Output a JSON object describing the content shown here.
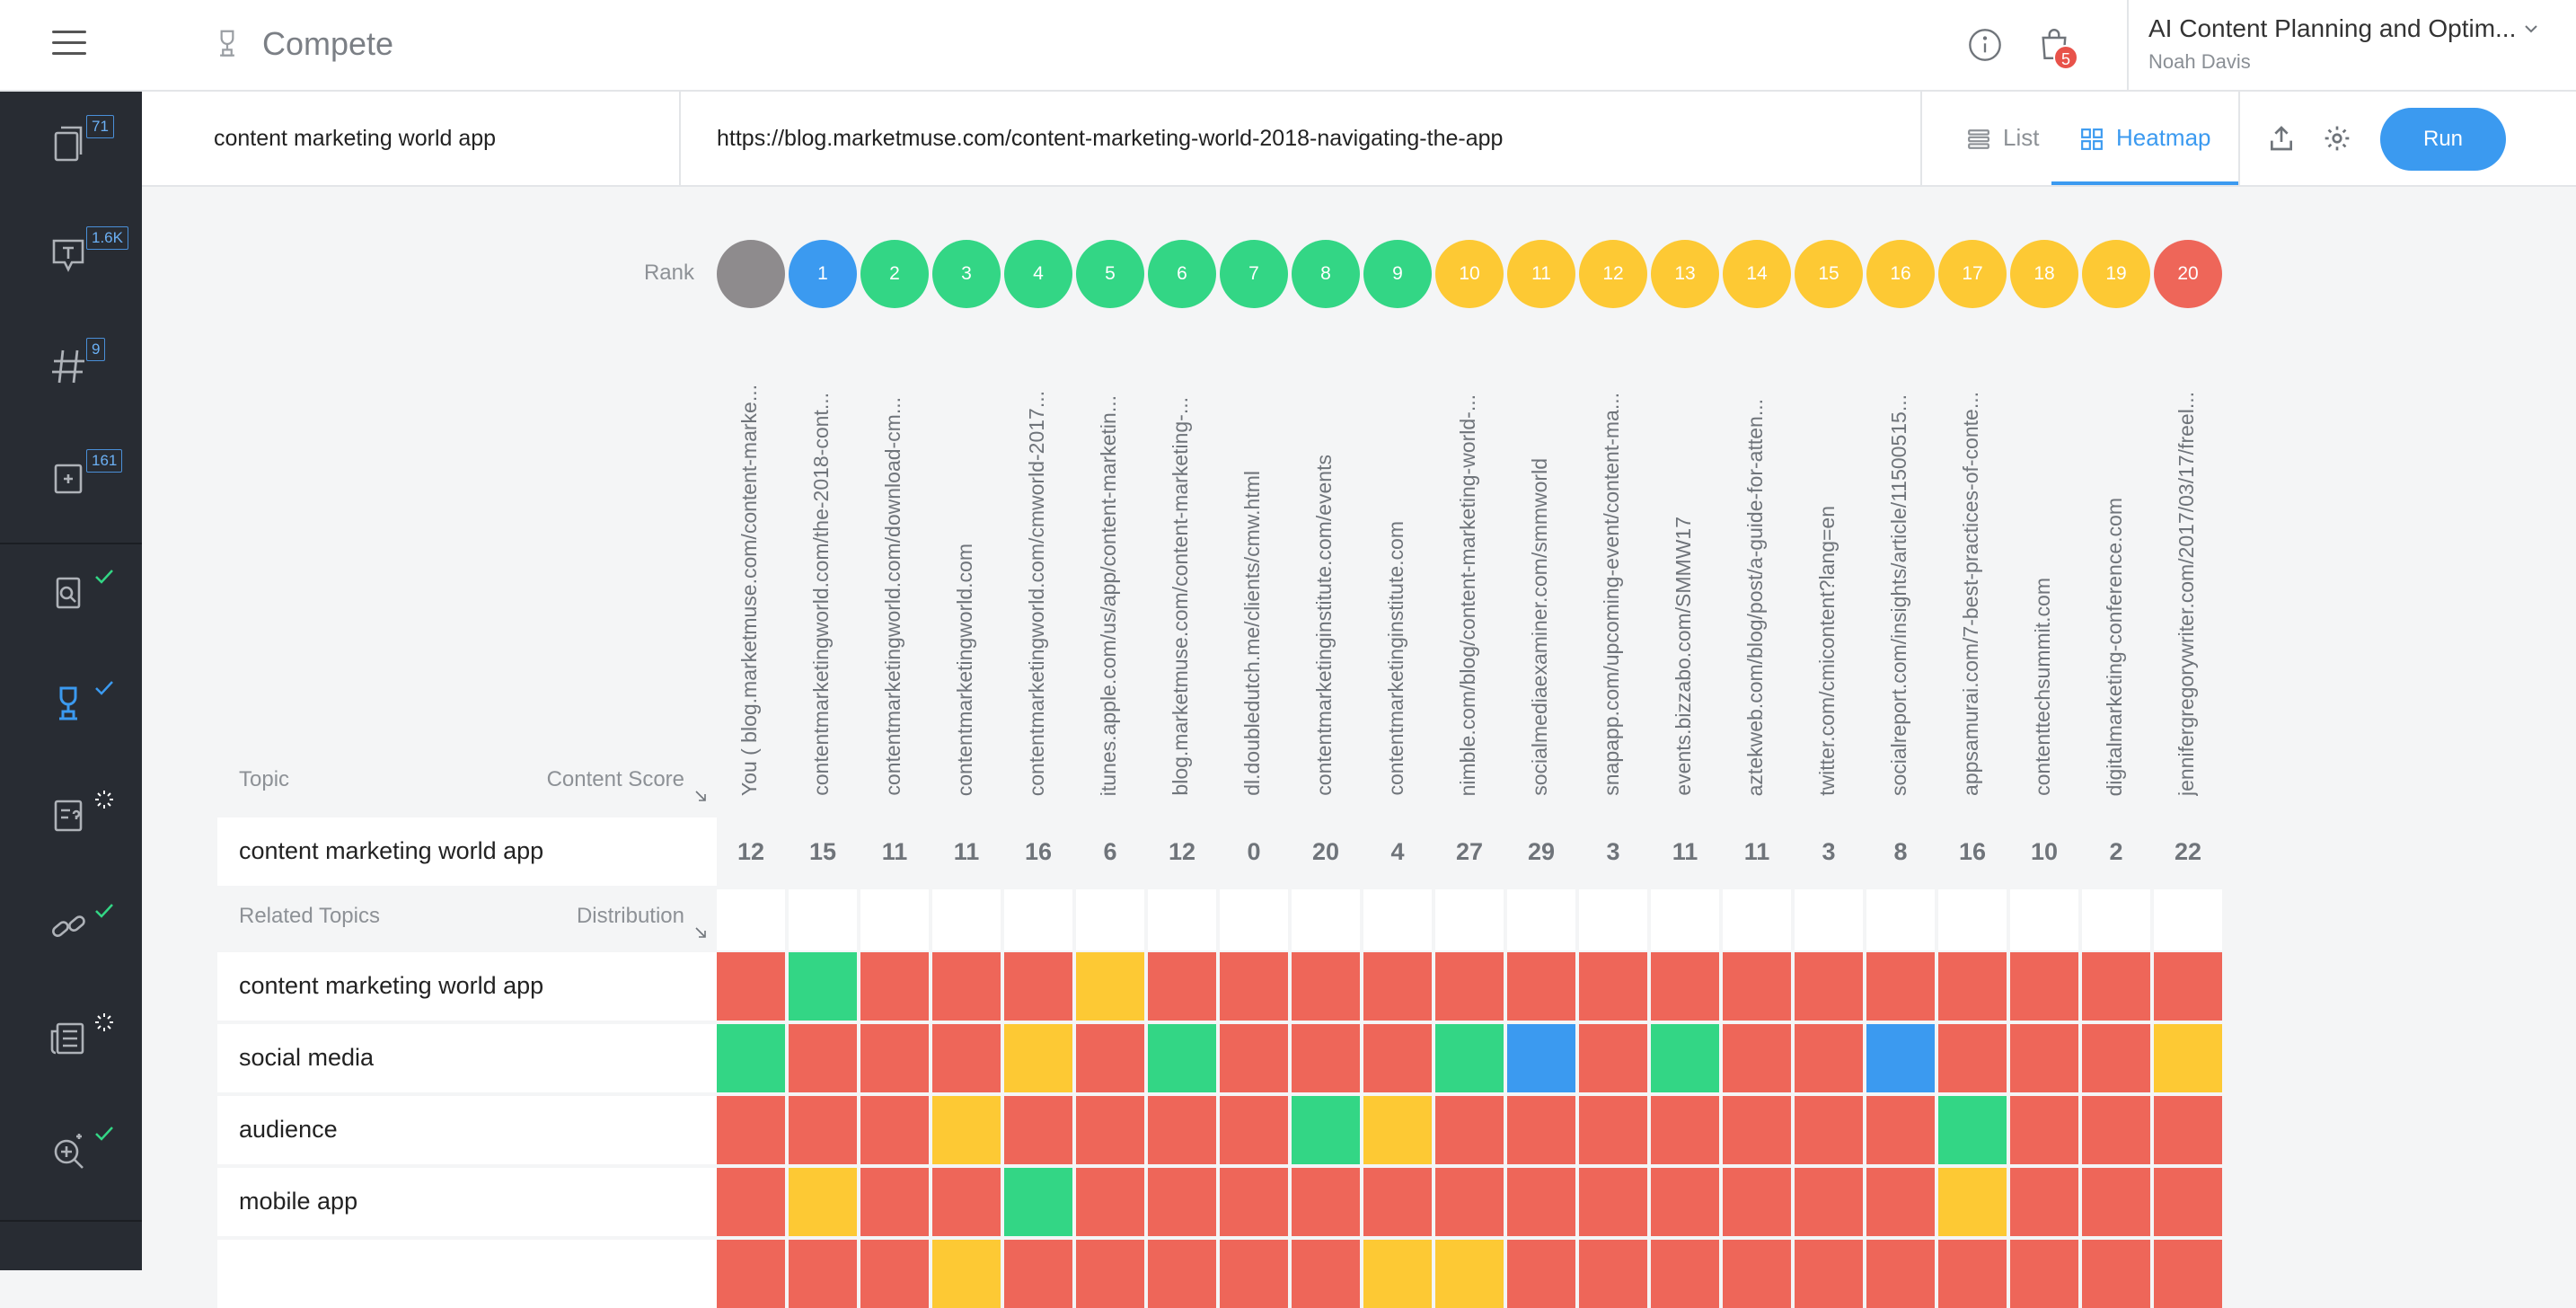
{
  "header": {
    "app_title": "Compete",
    "project_name": "AI Content Planning and Optim...",
    "user_name": "Noah Davis",
    "cart_count": "5"
  },
  "sidebar": {
    "badges": [
      "71",
      "1.6K",
      "9",
      "161"
    ]
  },
  "search": {
    "topic_value": "content marketing world app",
    "url_value": "https://blog.marketmuse.com/content-marketing-world-2018-navigating-the-app"
  },
  "view_tabs": {
    "list_label": "List",
    "heatmap_label": "Heatmap"
  },
  "run_label": "Run",
  "heatmap": {
    "rank_label": "Rank",
    "topic_header": "Topic",
    "score_header": "Content Score",
    "related_header": "Related Topics",
    "distribution_header": "Distribution",
    "focus_topic": "content marketing world app",
    "colors": {
      "gray": "#8e8b8d",
      "blue": "#3b9af0",
      "green": "#33d685",
      "yellow": "#fdc934",
      "red": "#ee6659"
    },
    "columns": [
      {
        "rank": "",
        "color": "gray",
        "url": "You ( blog.marketmuse.com/content-marke...",
        "score": "12"
      },
      {
        "rank": "1",
        "color": "blue",
        "url": "contentmarketingworld.com/the-2018-cont...",
        "score": "15"
      },
      {
        "rank": "2",
        "color": "green",
        "url": "contentmarketingworld.com/download-cm...",
        "score": "11"
      },
      {
        "rank": "3",
        "color": "green",
        "url": "contentmarketingworld.com",
        "score": "11"
      },
      {
        "rank": "4",
        "color": "green",
        "url": "contentmarketingworld.com/cmworld-2017...",
        "score": "16"
      },
      {
        "rank": "5",
        "color": "green",
        "url": "itunes.apple.com/us/app/content-marketin...",
        "score": "6"
      },
      {
        "rank": "6",
        "color": "green",
        "url": "blog.marketmuse.com/content-marketing-...",
        "score": "12"
      },
      {
        "rank": "7",
        "color": "green",
        "url": "dl.doubledutch.me/clients/cmw.html",
        "score": "0"
      },
      {
        "rank": "8",
        "color": "green",
        "url": "contentmarketinginstitute.com/events",
        "score": "20"
      },
      {
        "rank": "9",
        "color": "green",
        "url": "contentmarketinginstitute.com",
        "score": "4"
      },
      {
        "rank": "10",
        "color": "yellow",
        "url": "nimble.com/blog/content-marketing-world-...",
        "score": "27"
      },
      {
        "rank": "11",
        "color": "yellow",
        "url": "socialmediaexaminer.com/smmworld",
        "score": "29"
      },
      {
        "rank": "12",
        "color": "yellow",
        "url": "snapapp.com/upcoming-event/content-ma...",
        "score": "3"
      },
      {
        "rank": "13",
        "color": "yellow",
        "url": "events.bizzabo.com/SMMW17",
        "score": "11"
      },
      {
        "rank": "14",
        "color": "yellow",
        "url": "aztekweb.com/blog/post/a-guide-for-atten...",
        "score": "11"
      },
      {
        "rank": "15",
        "color": "yellow",
        "url": "twitter.com/cmicontent?lang=en",
        "score": "3"
      },
      {
        "rank": "16",
        "color": "yellow",
        "url": "socialreport.com/insights/article/11500515...",
        "score": "8"
      },
      {
        "rank": "17",
        "color": "yellow",
        "url": "appsamurai.com/7-best-practices-of-conte...",
        "score": "16"
      },
      {
        "rank": "18",
        "color": "yellow",
        "url": "contenttechsummit.com",
        "score": "10"
      },
      {
        "rank": "19",
        "color": "yellow",
        "url": "digitalmarketing-conference.com",
        "score": "2"
      },
      {
        "rank": "20",
        "color": "red",
        "url": "jennifergregorywriter.com/2017/03/17/freel...",
        "score": "22"
      }
    ],
    "rows": [
      {
        "topic": "content marketing world app",
        "cells": [
          "red",
          "green",
          "red",
          "red",
          "red",
          "yellow",
          "red",
          "red",
          "red",
          "red",
          "red",
          "red",
          "red",
          "red",
          "red",
          "red",
          "red",
          "red",
          "red",
          "red",
          "red"
        ]
      },
      {
        "topic": "social media",
        "cells": [
          "green",
          "red",
          "red",
          "red",
          "yellow",
          "red",
          "green",
          "red",
          "red",
          "red",
          "green",
          "blue",
          "red",
          "green",
          "red",
          "red",
          "blue",
          "red",
          "red",
          "red",
          "yellow"
        ]
      },
      {
        "topic": "audience",
        "cells": [
          "red",
          "red",
          "red",
          "yellow",
          "red",
          "red",
          "red",
          "red",
          "green",
          "yellow",
          "red",
          "red",
          "red",
          "red",
          "red",
          "red",
          "red",
          "green",
          "red",
          "red",
          "red"
        ]
      },
      {
        "topic": "mobile app",
        "cells": [
          "red",
          "yellow",
          "red",
          "red",
          "green",
          "red",
          "red",
          "red",
          "red",
          "red",
          "red",
          "red",
          "red",
          "red",
          "red",
          "red",
          "red",
          "yellow",
          "red",
          "red",
          "red"
        ]
      },
      {
        "topic": "",
        "cells": [
          "red",
          "red",
          "red",
          "yellow",
          "red",
          "red",
          "red",
          "red",
          "red",
          "yellow",
          "yellow",
          "red",
          "red",
          "red",
          "red",
          "red",
          "red",
          "red",
          "red",
          "red",
          "red"
        ]
      }
    ]
  }
}
